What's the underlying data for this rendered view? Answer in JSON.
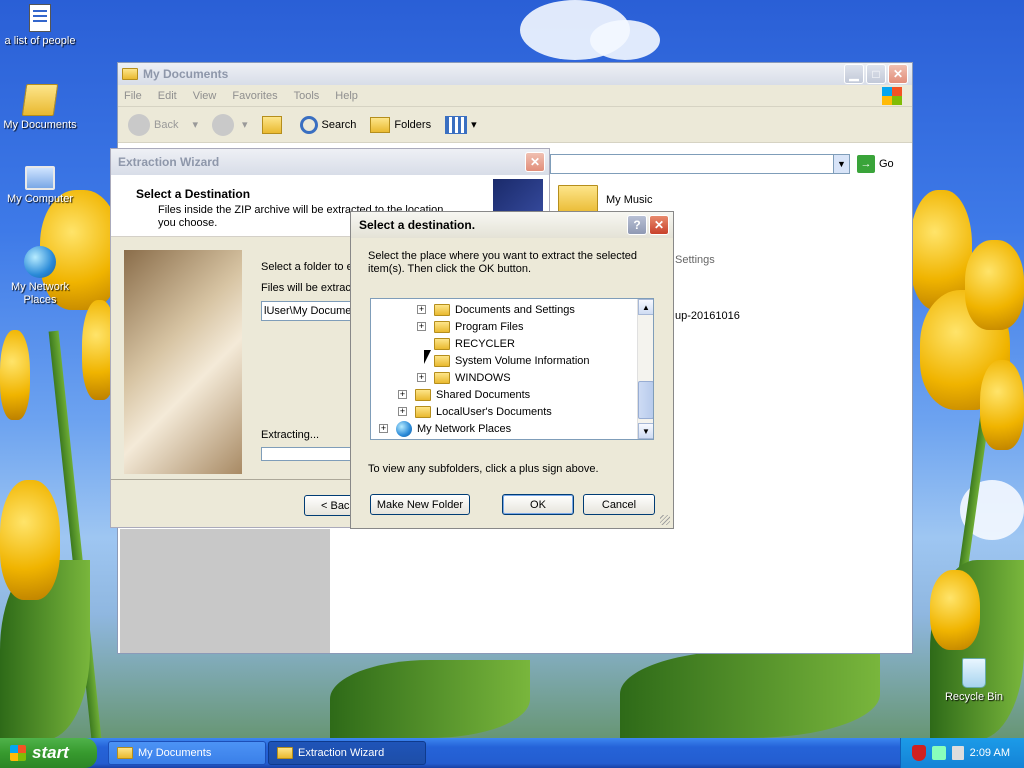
{
  "desktop": {
    "icons": [
      {
        "label": "a list of people"
      },
      {
        "label": "My Documents"
      },
      {
        "label": "My Computer"
      },
      {
        "label": "My Network Places"
      },
      {
        "label": "Recycle Bin"
      }
    ]
  },
  "mydocs": {
    "title": "My Documents",
    "menu": [
      "File",
      "Edit",
      "View",
      "Favorites",
      "Tools",
      "Help"
    ],
    "toolbar": {
      "back": "Back",
      "search": "Search",
      "folders": "Folders"
    },
    "go_label": "Go",
    "items": [
      {
        "label": "My Music"
      },
      {
        "label": "Settings"
      },
      {
        "label": "up-20161016"
      }
    ]
  },
  "wizard": {
    "title": "Extraction Wizard",
    "heading": "Select a Destination",
    "subheading": "Files inside the ZIP archive will be extracted to the location you choose.",
    "select_folder_text": "Select a folder to e",
    "files_will_text": "Files will be extract",
    "path_value": "lUser\\My Docume",
    "extracting_label": "Extracting...",
    "back_button": "< Bac"
  },
  "dialog": {
    "title": "Select a destination.",
    "help": "?",
    "instructions": "Select the place where you want to extract the selected item(s).  Then click the OK button.",
    "tree": [
      {
        "label": "Documents and Settings",
        "expandable": true
      },
      {
        "label": "Program Files",
        "expandable": true
      },
      {
        "label": "RECYCLER",
        "expandable": false
      },
      {
        "label": "System Volume Information",
        "expandable": false
      },
      {
        "label": "WINDOWS",
        "expandable": true
      },
      {
        "label": "Shared Documents",
        "expandable": true
      },
      {
        "label": "LocalUser's Documents",
        "expandable": true
      },
      {
        "label": "My Network Places",
        "expandable": true
      }
    ],
    "hint": "To view any subfolders, click a plus sign above.",
    "make_new_folder": "Make New Folder",
    "ok": "OK",
    "cancel": "Cancel"
  },
  "taskbar": {
    "start": "start",
    "tasks": [
      {
        "label": "My Documents"
      },
      {
        "label": "Extraction Wizard"
      }
    ],
    "clock": "2:09 AM"
  }
}
